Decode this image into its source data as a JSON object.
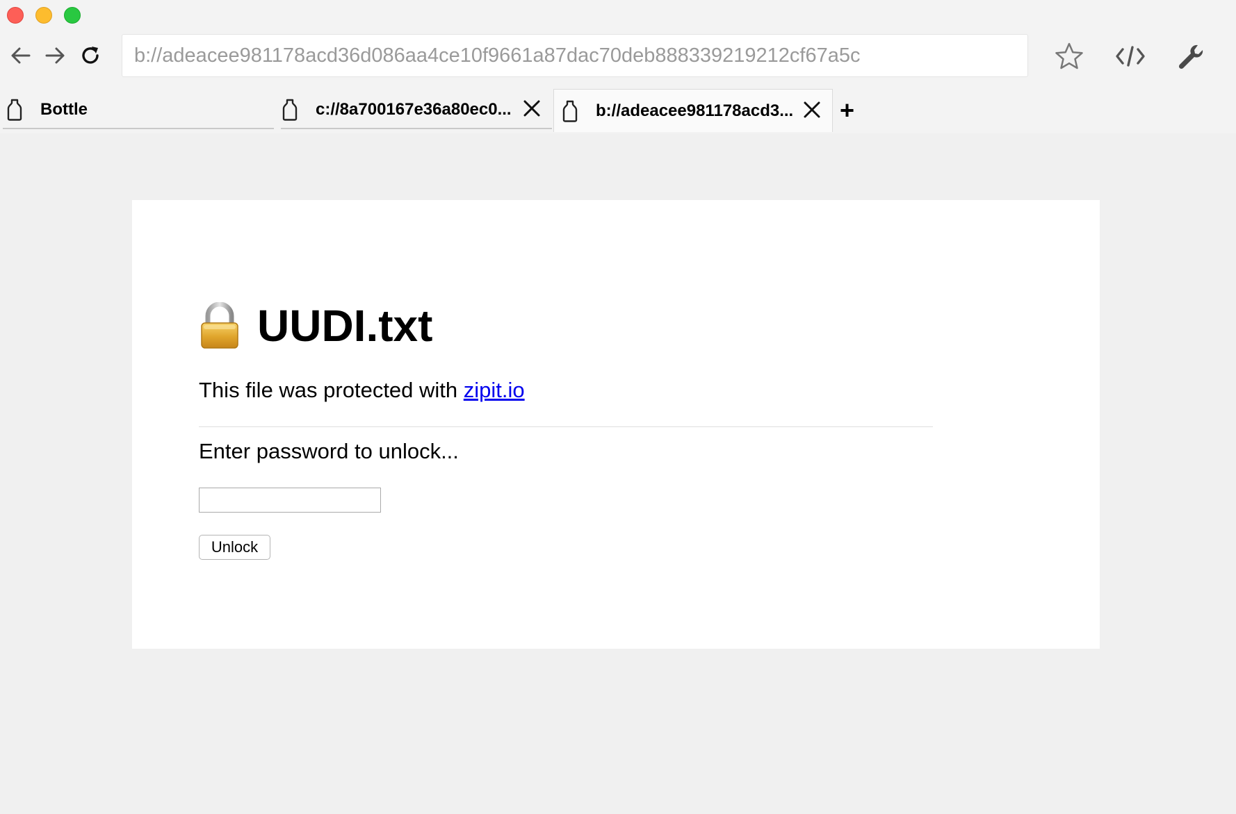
{
  "browser": {
    "url": "b://adeacee981178acd36d086aa4ce10f9661a87dac70deb888339219212cf67a5c",
    "tabs": [
      {
        "label": "Bottle",
        "closable": false,
        "active": false
      },
      {
        "label": "c://8a700167e36a80ec0...",
        "closable": true,
        "active": false
      },
      {
        "label": "b://adeacee981178acd3...",
        "closable": true,
        "active": true
      }
    ],
    "new_tab_label": "+"
  },
  "page": {
    "title": "UUDI.txt",
    "intro_text": "This file was protected with ",
    "intro_link": "zipit.io",
    "prompt": "Enter password to unlock...",
    "password_value": "",
    "unlock_label": "Unlock"
  },
  "colors": {
    "link": "#0000ee",
    "page_background": "#f0f0f0",
    "card_background": "#ffffff"
  },
  "icons": {
    "traffic_lights": [
      "close-window-icon",
      "minimize-window-icon",
      "zoom-window-icon"
    ],
    "nav": [
      "back-arrow-icon",
      "forward-arrow-icon",
      "reload-icon"
    ],
    "tools": [
      "bookmark-star-icon",
      "view-source-icon",
      "wrench-icon"
    ],
    "tab_icon": "bottle-icon",
    "title_icon": "lock-icon"
  }
}
